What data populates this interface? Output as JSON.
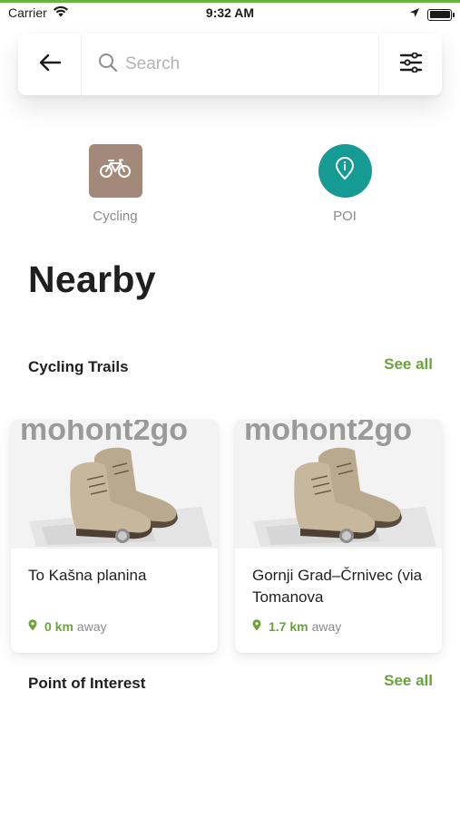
{
  "status_bar": {
    "carrier": "Carrier",
    "time": "9:32 AM"
  },
  "search": {
    "placeholder": "Search",
    "value": ""
  },
  "categories": [
    {
      "label": "Cycling",
      "icon": "bicycle-icon",
      "color": "#a3897a"
    },
    {
      "label": "POI",
      "icon": "map-pin-icon",
      "color": "#169a94"
    }
  ],
  "nearby": {
    "title": "Nearby"
  },
  "sections": {
    "cycling_trails": {
      "title": "Cycling Trails",
      "see_all": "See all"
    },
    "points_of_interest": {
      "title": "Point of Interest",
      "see_all": "See all"
    }
  },
  "trails": [
    {
      "title": "To Kašna planina",
      "distance": "0 km",
      "suffix": "away",
      "image_text": "mohont2go"
    },
    {
      "title": "Gornji Grad–Črnivec (via Tomanova",
      "distance": "1.7 km",
      "suffix": "away",
      "image_text": "mohont2go"
    }
  ],
  "colors": {
    "accent": "#6aa33a",
    "top_bar": "#6ab33e"
  }
}
